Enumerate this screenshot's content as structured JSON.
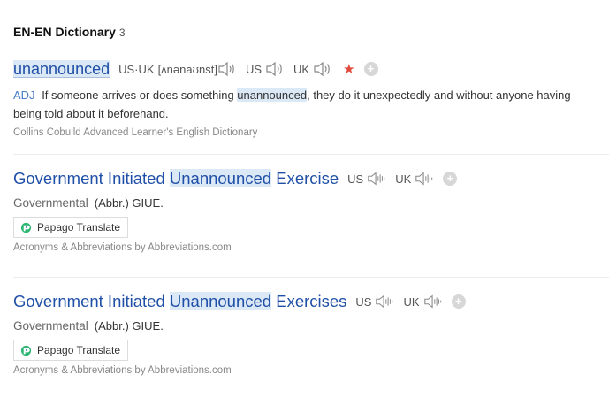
{
  "header": {
    "title": "EN-EN Dictionary",
    "count": "3"
  },
  "entry1": {
    "headword": "unannounced",
    "pron_label": "US·UK",
    "phonetic": "[ʌnənaʊnst]",
    "us_label": "US",
    "uk_label": "UK",
    "pos": "ADJ",
    "def_before": "If someone arrives or does something ",
    "def_highlight": "unannounced",
    "def_after": ", they do it unexpectedly and without anyone having being told about it beforehand.",
    "source": "Collins Cobuild Advanced Learner's English Dictionary"
  },
  "entry2": {
    "title_before": "Government Initiated ",
    "title_highlight": "Unannounced",
    "title_after": " Exercise",
    "us_label": "US",
    "uk_label": "UK",
    "field": "Governmental",
    "abbr": "(Abbr.) GIUE.",
    "translate_label": "Papago Translate",
    "source": "Acronyms & Abbreviations by Abbreviations.com"
  },
  "entry3": {
    "title_before": "Government Initiated ",
    "title_highlight": "Unannounced",
    "title_after": " Exercises",
    "us_label": "US",
    "uk_label": "UK",
    "field": "Governmental",
    "abbr": "(Abbr.) GIUE.",
    "translate_label": "Papago Translate",
    "source": "Acronyms & Abbreviations by Abbreviations.com"
  },
  "colors": {
    "link": "#1f4fa6",
    "highlight": "#dbe8f6",
    "star": "#e04a3c"
  }
}
